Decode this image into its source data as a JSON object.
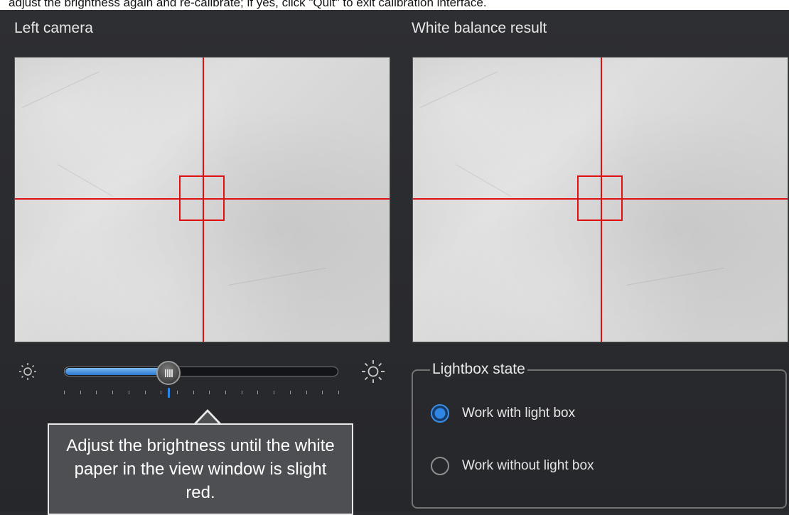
{
  "instruction_banner": "adjust the brightness again and re-calibrate; if yes, click \"Quit\" to exit calibration interface.",
  "left_panel": {
    "title": "Left camera"
  },
  "right_panel": {
    "title": "White balance result"
  },
  "brightness": {
    "min_icon": "sun-dim-icon",
    "max_icon": "sun-bright-icon",
    "value_fraction": 0.38,
    "tick_count": 18,
    "tooltip": "Adjust the brightness until the white paper in the view window is slight red."
  },
  "lightbox": {
    "title": "Lightbox state",
    "options": [
      {
        "label": "Work with light box",
        "checked": true
      },
      {
        "label": "Work without light box",
        "checked": false
      }
    ]
  },
  "colors": {
    "accent": "#2f86e4",
    "crosshair": "#e01010",
    "background": "#2a2b2f"
  }
}
